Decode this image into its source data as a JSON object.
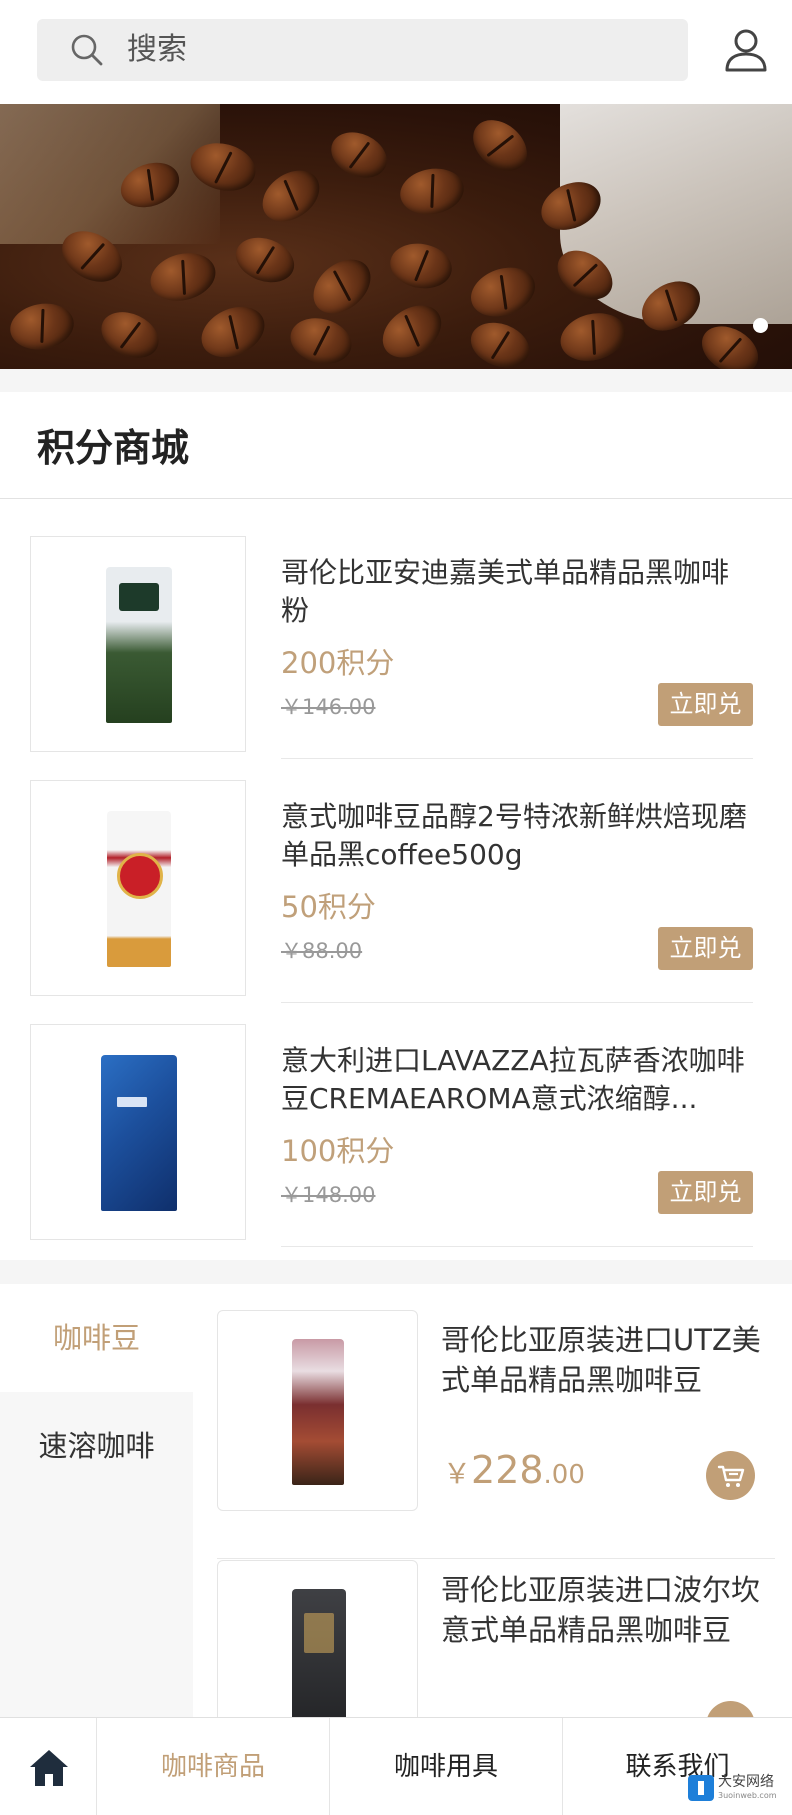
{
  "search": {
    "placeholder": "搜索"
  },
  "points_mall": {
    "title": "积分商城",
    "redeem_label": "立即兑",
    "items": [
      {
        "name": "哥伦比亚安迪嘉美式单品精品黑咖啡粉",
        "points": "200积分",
        "original_price": "￥146.00"
      },
      {
        "name": "意式咖啡豆品醇2号特浓新鲜烘焙现磨单品黑coffee500g",
        "points": "50积分",
        "original_price": "￥88.00"
      },
      {
        "name": "意大利进口LAVAZZA拉瓦萨香浓咖啡豆CREMAEAROMA意式浓缩醇...",
        "points": "100积分",
        "original_price": "￥148.00"
      }
    ]
  },
  "categories": {
    "items": [
      {
        "label": "咖啡豆",
        "active": true
      },
      {
        "label": "速溶咖啡",
        "active": false
      }
    ]
  },
  "goods": [
    {
      "name": "哥伦比亚原装进口UTZ美式单品精品黑咖啡豆",
      "currency": "￥",
      "price_int": "228",
      "price_dec": ".00"
    },
    {
      "name": "哥伦比亚原装进口波尔坎意式单品精品黑咖啡豆",
      "currency": "",
      "price_int": "",
      "price_dec": ""
    }
  ],
  "bottom_nav": {
    "tabs": [
      {
        "label": "咖啡商品",
        "active": true
      },
      {
        "label": "咖啡用具",
        "active": false
      },
      {
        "label": "联系我们",
        "active": false
      }
    ]
  },
  "watermark": {
    "text": "大安网络",
    "sub": "3uoinweb.com"
  },
  "colors": {
    "accent": "#c19f77",
    "text": "#333333",
    "background": "#f5f5f5"
  },
  "icons": [
    "search-icon",
    "user-icon",
    "cart-icon",
    "home-icon"
  ]
}
